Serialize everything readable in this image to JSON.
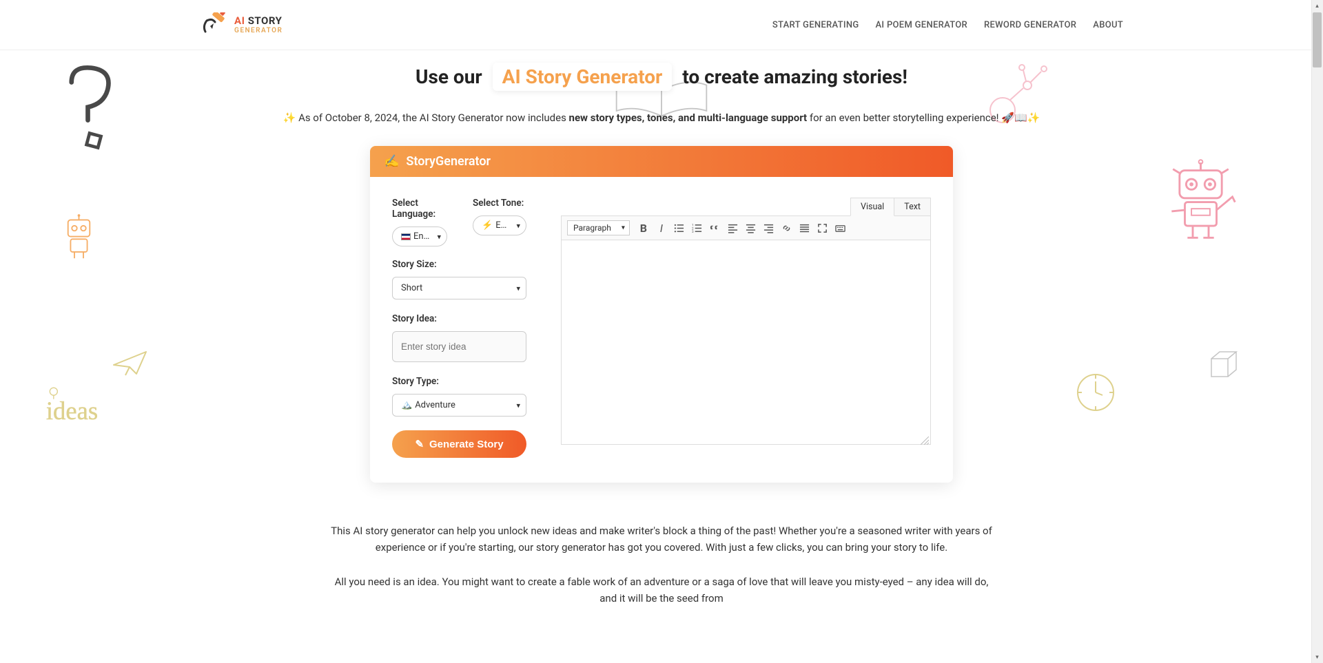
{
  "brand": {
    "line1_ai": "AI",
    "line1_story": " STORY",
    "line2": "GENERATOR"
  },
  "nav": {
    "start": "START GENERATING",
    "poem": "AI POEM GENERATOR",
    "reword": "REWORD GENERATOR",
    "about": "ABOUT"
  },
  "hero": {
    "pre": "Use our",
    "highlight": "AI Story Generator",
    "post": " to create amazing stories!",
    "sub_pre": " As of October 8, 2024, the AI Story Generator now includes ",
    "sub_bold": "new story types, tones, and multi-language support",
    "sub_post": " for an even better storytelling experience! "
  },
  "widget": {
    "title": "StoryGenerator",
    "language_label": "Select Language:",
    "language_value": "English",
    "tone_label": "Select Tone:",
    "tone_value": "Exciting",
    "size_label": "Story Size:",
    "size_value": "Short",
    "idea_label": "Story Idea:",
    "idea_placeholder": "Enter story idea",
    "type_label": "Story Type:",
    "type_value": "Adventure",
    "generate": "Generate Story"
  },
  "editor": {
    "tab_visual": "Visual",
    "tab_text": "Text",
    "paragraph": "Paragraph"
  },
  "footer": {
    "p1": "This AI story generator can help you unlock new ideas and make writer's block a thing of the past! Whether you're a seasoned writer with years of experience or if you're starting, our story generator has got you covered. With just a few clicks, you can bring your story to life.",
    "p2": "All you need is an idea. You might want to create a fable work of an adventure or a saga of love that will leave you misty-eyed – any idea will do, and it will be the seed from"
  }
}
